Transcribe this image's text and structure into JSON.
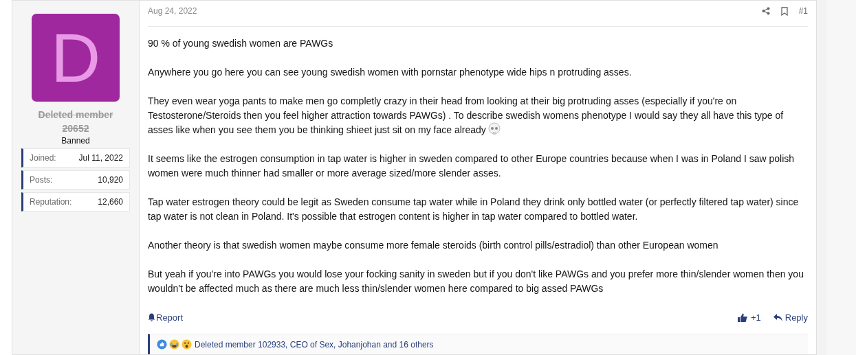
{
  "author": {
    "avatar_letter": "D",
    "name": "Deleted member 20652",
    "deleted": true,
    "title": "Banned",
    "stats": [
      {
        "label": "Joined:",
        "value": "Jul 11, 2022"
      },
      {
        "label": "Posts:",
        "value": "10,920"
      },
      {
        "label": "Reputation:",
        "value": "12,660"
      }
    ]
  },
  "post": {
    "date": "Aug 24, 2022",
    "number": "#1",
    "paragraphs": [
      {
        "text": "90 % of young swedish women are PAWGs",
        "trailing_emoji": false
      },
      {
        "text": "Anywhere you go here you can see young swedish women with pornstar phenotype wide hips n protruding asses.",
        "trailing_emoji": false
      },
      {
        "text": "They even wear yoga pants to make men go completly crazy in their head from looking at their big protruding asses (especially if you're on Testosterone/Steroids then you feel higher attraction towards PAWGs) . To describe swedish womens phenotype I would say they all have this type of asses like when you see them you be thinking shieet just sit on my face already",
        "trailing_emoji": true
      },
      {
        "text": "It seems like the estrogen consumption in tap water is higher in sweden compared to other Europe countries because when I was in Poland I saw polish women were much thinner had smaller or more average sized/more slender asses.",
        "trailing_emoji": false
      },
      {
        "text": "Tap water estrogen theory could be legit as Sweden consume tap water while in Poland they drink only bottled water (or perfectly filtered tap water) since tap water is not clean in Poland. It's possible that estrogen content is higher in tap water compared to bottled water.",
        "trailing_emoji": false
      },
      {
        "text": "Another theory is that swedish women maybe consume more female steroids (birth control pills/estradiol) than other European women",
        "trailing_emoji": false
      },
      {
        "text": "But yeah if you're into PAWGs you would lose your focking sanity in sweden but if you don't like PAWGs and you prefer more thin/slender women then you wouldn't be affected much as there are much less thin/slender women here compared to big assed PAWGs",
        "trailing_emoji": false
      }
    ],
    "actions": {
      "report": "Report",
      "like": "+1",
      "reply": "Reply"
    },
    "reactions": {
      "text": "Deleted member 102933, CEO of Sex, Johanjohan and 16 others"
    }
  }
}
